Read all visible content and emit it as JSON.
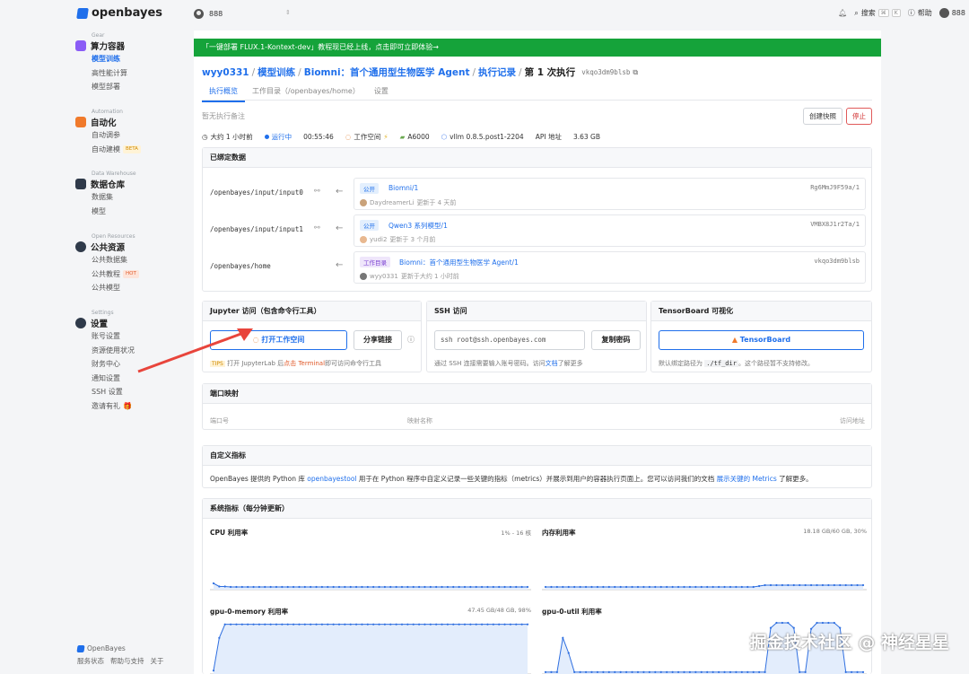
{
  "brand": {
    "name": "openbayes"
  },
  "topbar": {
    "org": "888",
    "search": "搜索",
    "kbd1": "⌘",
    "kbd2": "K",
    "help": "帮助",
    "user": "888"
  },
  "sidebar": {
    "groups": [
      {
        "cat": "Gear",
        "title": "算力容器",
        "items": [
          "模型训练",
          "高性能计算",
          "模型部署"
        ]
      },
      {
        "cat": "Automation",
        "title": "自动化",
        "items": [
          "自动调参",
          "自动建模"
        ],
        "badge": "BETA"
      },
      {
        "cat": "Data Warehouse",
        "title": "数据仓库",
        "items": [
          "数据集",
          "模型"
        ]
      },
      {
        "cat": "Open Resources",
        "title": "公共资源",
        "items": [
          "公共数据集",
          "公共教程",
          "公共模型"
        ],
        "badge": "HOT"
      },
      {
        "cat": "Settings",
        "title": "设置",
        "items": [
          "账号设置",
          "资源使用状况",
          "财务中心",
          "通知设置",
          "SSH 设置",
          "邀请有礼"
        ]
      }
    ],
    "footer": {
      "brand": "OpenBayes",
      "links": [
        "服务状态",
        "帮助与支持",
        "关于"
      ]
    }
  },
  "announce": "「一键部署 FLUX.1-Kontext-dev」教程现已经上线，点击即可立即体验→",
  "breadcrumb": {
    "user": "wyy0331",
    "c1": "模型训练",
    "c2": "Biomni：首个通用型生物医学 Agent",
    "c3": "执行记录",
    "cur": "第 1 次执行",
    "hash": "vkqo3dm9blsb"
  },
  "tabs": [
    "执行概览",
    "工作目录（/openbayes/home）",
    "设置"
  ],
  "note": "暂无执行备注",
  "actions": {
    "snapshot": "创建快照",
    "stop": "停止"
  },
  "meta": {
    "time": "大约 1 小时前",
    "status": "运行中",
    "elapsed": "00:55:46",
    "workspace": "工作空间",
    "gpu": "A6000",
    "image": "vllm 0.8.5.post1-2204",
    "api": "API 地址",
    "storage": "3.63 GB"
  },
  "bound": {
    "title": "已绑定数据",
    "rows": [
      {
        "path": "/openbayes/input/input0",
        "tag": "公开",
        "name": "Biomni/1",
        "who": "DaydreamerLi",
        "when": "更新于 4 天前",
        "hash": "Rg6MmJ9F59a/1"
      },
      {
        "path": "/openbayes/input/input1",
        "tag": "公开",
        "name": "Qwen3 系列模型/1",
        "who": "yudi2",
        "when": "更新于 3 个月前",
        "hash": "VMBX8J1r2Ta/1"
      },
      {
        "path": "/openbayes/home",
        "tag": "工作目录",
        "name": "Biomni：首个通用型生物医学 Agent/1",
        "who": "wyy0331",
        "when": "更新于大约 1 小时前",
        "hash": "vkqo3dm9blsb"
      }
    ]
  },
  "jupyter": {
    "title": "Jupyter 访问（包含命令行工具）",
    "open": "打开工作空间",
    "share": "分享链接",
    "tips": "TIPS",
    "tip_text1": "打开 JupyterLab 后",
    "tip_link": "点击 Terminal",
    "tip_text2": "即可访问命令行工具"
  },
  "ssh": {
    "title": "SSH 访问",
    "cmd": "ssh root@ssh.openbayes.com",
    "copy": "复制密码",
    "desc1": "通过 SSH 连接需要输入账号密码。访问",
    "doc": "文档",
    "desc2": "了解更多"
  },
  "tensorboard": {
    "title": "TensorBoard 可视化",
    "btn": "TensorBoard",
    "desc1": "默认绑定路径为",
    "path": "./tf_dir",
    "desc2": "。这个路径暂不支持修改。"
  },
  "ports": {
    "title": "端口映射",
    "cols": [
      "端口号",
      "映射名称",
      "访问地址"
    ]
  },
  "custom": {
    "title": "自定义指标",
    "t1": "OpenBayes 提供的 Python 库",
    "lib": "openbayestool",
    "t2": "用于在 Python 程序中自定义记录一些关键的指标（metrics）并展示到用户的容器执行页面上。您可以访问我们的文档",
    "link": "展示关键的 Metrics",
    "t3": "了解更多。"
  },
  "sys": {
    "title": "系统指标（每分钟更新）"
  },
  "chart_data": [
    {
      "type": "line",
      "title": "CPU 利用率",
      "subtitle": "1% - 16 核",
      "values": [
        12,
        5,
        5,
        4,
        4,
        4,
        4,
        4,
        4,
        4,
        4,
        4,
        4,
        4,
        4,
        4,
        4,
        4,
        4,
        4,
        4,
        4,
        4,
        4,
        4,
        4,
        4,
        4,
        4,
        4,
        4,
        4,
        4,
        4,
        4,
        4,
        4,
        4,
        4,
        4,
        4,
        4,
        4,
        4,
        4,
        4,
        4,
        4,
        4,
        4,
        4,
        4,
        4,
        4,
        4,
        4
      ]
    },
    {
      "type": "line",
      "title": "内存利用率",
      "subtitle": "18.18 GB/60 GB, 30%",
      "values": [
        4,
        4,
        4,
        4,
        4,
        4,
        4,
        4,
        4,
        4,
        4,
        4,
        4,
        4,
        4,
        4,
        4,
        4,
        4,
        4,
        4,
        4,
        4,
        4,
        4,
        4,
        4,
        4,
        4,
        4,
        4,
        4,
        4,
        4,
        4,
        4,
        4,
        6,
        8,
        8,
        8,
        8,
        8,
        8,
        8,
        8,
        8,
        8,
        8,
        8,
        8,
        8,
        8,
        8,
        8,
        8
      ]
    },
    {
      "type": "line",
      "title": "gpu-0-memory 利用率",
      "subtitle": "47.45 GB/48 GB, 98%",
      "values": [
        5,
        70,
        97,
        97,
        97,
        97,
        97,
        97,
        97,
        97,
        97,
        97,
        97,
        97,
        97,
        97,
        97,
        97,
        97,
        97,
        97,
        97,
        97,
        97,
        97,
        97,
        97,
        97,
        97,
        97,
        97,
        97,
        97,
        97,
        97,
        97,
        97,
        97,
        97,
        97,
        97,
        97,
        97,
        97,
        97,
        97,
        97,
        97,
        97,
        97,
        97,
        97,
        97,
        97,
        97,
        97
      ]
    },
    {
      "type": "line",
      "title": "gpu-0-util 利用率",
      "subtitle": "",
      "values": [
        2,
        2,
        2,
        70,
        40,
        2,
        2,
        2,
        2,
        2,
        2,
        2,
        2,
        2,
        2,
        2,
        2,
        2,
        2,
        2,
        2,
        2,
        2,
        2,
        2,
        2,
        2,
        2,
        2,
        2,
        2,
        2,
        2,
        2,
        2,
        2,
        2,
        2,
        2,
        90,
        100,
        100,
        100,
        90,
        2,
        2,
        88,
        100,
        100,
        100,
        100,
        90,
        2,
        2,
        2,
        2
      ]
    }
  ],
  "watermark": "掘金技术社区 @ 神经星星"
}
